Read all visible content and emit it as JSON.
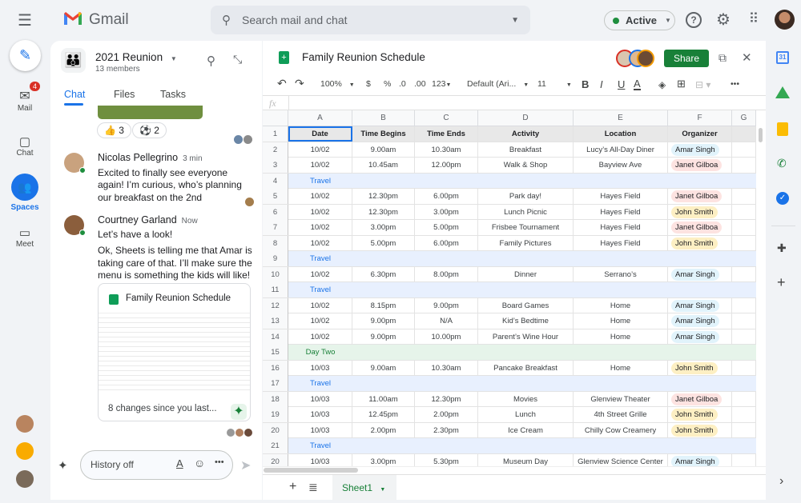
{
  "topbar": {
    "app_name": "Gmail",
    "search_placeholder": "Search mail and chat",
    "status": "Active"
  },
  "rail": {
    "mail": "Mail",
    "mail_badge": "4",
    "chat": "Chat",
    "spaces": "Spaces",
    "meet": "Meet"
  },
  "space": {
    "title": "2021 Reunion",
    "members": "13 members",
    "tabs": [
      "Chat",
      "Files",
      "Tasks"
    ],
    "reactions": [
      {
        "emoji": "👍",
        "count": "3"
      },
      {
        "emoji": "⚽",
        "count": "2"
      }
    ],
    "messages": [
      {
        "author": "Nicolas Pellegrino",
        "time": "3 min",
        "text": [
          "Excited to finally see everyone again! I’m curious, who’s planning our breakfast on the 2nd"
        ]
      },
      {
        "author": "Courtney Garland",
        "time": "Now",
        "text": [
          "Let’s have a look!",
          "Ok, Sheets is telling me that Amar is taking care of that. I’ll make sure the menu is something the kids will like!"
        ]
      }
    ],
    "card": {
      "title": "Family Reunion Schedule",
      "footer": "8 changes since you last..."
    },
    "composer": {
      "placeholder": "History off"
    }
  },
  "sheet": {
    "title": "Family Reunion Schedule",
    "share": "Share",
    "toolbar": {
      "zoom": "100%",
      "currency": "$",
      "percent": "%",
      "dec_less": ".0",
      "dec_more": ".00",
      "format": "123",
      "font": "Default (Ari...",
      "size": "11",
      "bold": "B",
      "italic": "I",
      "underline": "U",
      "color": "A",
      "more": "•••"
    },
    "fx": "fx",
    "columns": [
      "A",
      "B",
      "C",
      "D",
      "E",
      "F",
      "G"
    ],
    "header": [
      "Date",
      "Time Begins",
      "Time Ends",
      "Activity",
      "Location",
      "Organizer"
    ],
    "rows": [
      {
        "n": "2",
        "cells": [
          "10/02",
          "9.00am",
          "10.30am",
          "Breakfast",
          "Lucy’s All-Day Diner",
          "Amar Singh"
        ]
      },
      {
        "n": "3",
        "cells": [
          "10/02",
          "10.45am",
          "12.00pm",
          "Walk & Shop",
          "Bayview Ave",
          "Janet Gilboa"
        ]
      },
      {
        "n": "4",
        "section": "Travel",
        "kind": "travel"
      },
      {
        "n": "5",
        "cells": [
          "10/02",
          "12.30pm",
          "6.00pm",
          "Park day!",
          "Hayes Field",
          "Janet Gilboa"
        ]
      },
      {
        "n": "6",
        "cells": [
          "10/02",
          "12.30pm",
          "3.00pm",
          "Lunch Picnic",
          "Hayes Field",
          "John Smith"
        ]
      },
      {
        "n": "7",
        "cells": [
          "10/02",
          "3.00pm",
          "5.00pm",
          "Frisbee Tournament",
          "Hayes Field",
          "Janet Gilboa"
        ]
      },
      {
        "n": "8",
        "cells": [
          "10/02",
          "5.00pm",
          "6.00pm",
          "Family Pictures",
          "Hayes Field",
          "John Smith"
        ]
      },
      {
        "n": "9",
        "section": "Travel",
        "kind": "travel"
      },
      {
        "n": "10",
        "cells": [
          "10/02",
          "6.30pm",
          "8.00pm",
          "Dinner",
          "Serrano’s",
          "Amar Singh"
        ]
      },
      {
        "n": "11",
        "section": "Travel",
        "kind": "travel"
      },
      {
        "n": "12",
        "cells": [
          "10/02",
          "8.15pm",
          "9.00pm",
          "Board Games",
          "Home",
          "Amar Singh"
        ]
      },
      {
        "n": "13",
        "cells": [
          "10/02",
          "9.00pm",
          "N/A",
          "Kid’s Bedtime",
          "Home",
          "Amar Singh"
        ]
      },
      {
        "n": "14",
        "cells": [
          "10/02",
          "9.00pm",
          "10.00pm",
          "Parent’s Wine Hour",
          "Home",
          "Amar Singh"
        ]
      },
      {
        "n": "15",
        "section": "Day Two",
        "kind": "day"
      },
      {
        "n": "16",
        "cells": [
          "10/03",
          "9.00am",
          "10.30am",
          "Pancake Breakfast",
          "Home",
          "John Smith"
        ]
      },
      {
        "n": "17",
        "section": "Travel",
        "kind": "travel"
      },
      {
        "n": "18",
        "cells": [
          "10/03",
          "11.00am",
          "12.30pm",
          "Movies",
          "Glenview Theater",
          "Janet Gilboa"
        ]
      },
      {
        "n": "19",
        "cells": [
          "10/03",
          "12.45pm",
          "2.00pm",
          "Lunch",
          "4th Street Grille",
          "John Smith"
        ]
      },
      {
        "n": "20",
        "cells": [
          "10/03",
          "2.00pm",
          "2.30pm",
          "Ice Cream",
          "Chilly Cow Creamery",
          "John Smith"
        ]
      },
      {
        "n": "21",
        "section": "Travel",
        "kind": "travel"
      },
      {
        "n": "20",
        "cells": [
          "10/03",
          "3.00pm",
          "5.30pm",
          "Museum Day",
          "Glenview Science Center",
          "Amar Singh"
        ]
      }
    ],
    "sheet_tab": "Sheet1"
  },
  "colors": {
    "accent": "#1a73e8",
    "share": "#188038",
    "chip_amar": "#e1f3fb",
    "chip_janet": "#fde3e1",
    "chip_john": "#fdefc3",
    "travel_bg": "#e8f0fe",
    "day_bg": "#e6f4ea"
  }
}
